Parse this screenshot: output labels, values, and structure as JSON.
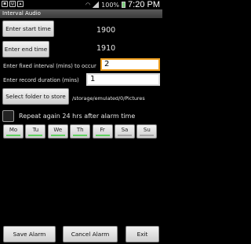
{
  "status_bar": {
    "left_icons": [
      "notification-icon",
      "usb-icon",
      "image-icon"
    ],
    "battery": "100%",
    "time": "7:20 PM"
  },
  "app": {
    "title": "Interval Audio"
  },
  "start": {
    "button_label": "Enter start time",
    "value": "1900"
  },
  "end": {
    "button_label": "Enter end time",
    "value": "1910"
  },
  "interval": {
    "label": "Enter fixed interval (mins) to occur",
    "value": "2"
  },
  "duration": {
    "label": "Enter record duration (mins)",
    "value": "1"
  },
  "folder": {
    "button_label": "Select folder to store",
    "path": "/storage/emulated/0/Pictures"
  },
  "repeat": {
    "label": "Repeat again 24 hrs after alarm time",
    "checked": false
  },
  "days": [
    {
      "label": "Mo",
      "active": true
    },
    {
      "label": "Tu",
      "active": true
    },
    {
      "label": "We",
      "active": true
    },
    {
      "label": "Th",
      "active": true
    },
    {
      "label": "Fr",
      "active": true
    },
    {
      "label": "Sa",
      "active": false
    },
    {
      "label": "Su",
      "active": false
    }
  ],
  "actions": {
    "save": "Save Alarm",
    "cancel": "Cancel Alarm",
    "exit": "Exit"
  },
  "colors": {
    "day_active": "#5fd25f",
    "day_inactive": "#a6a6a6",
    "focus": "#f0a020"
  }
}
